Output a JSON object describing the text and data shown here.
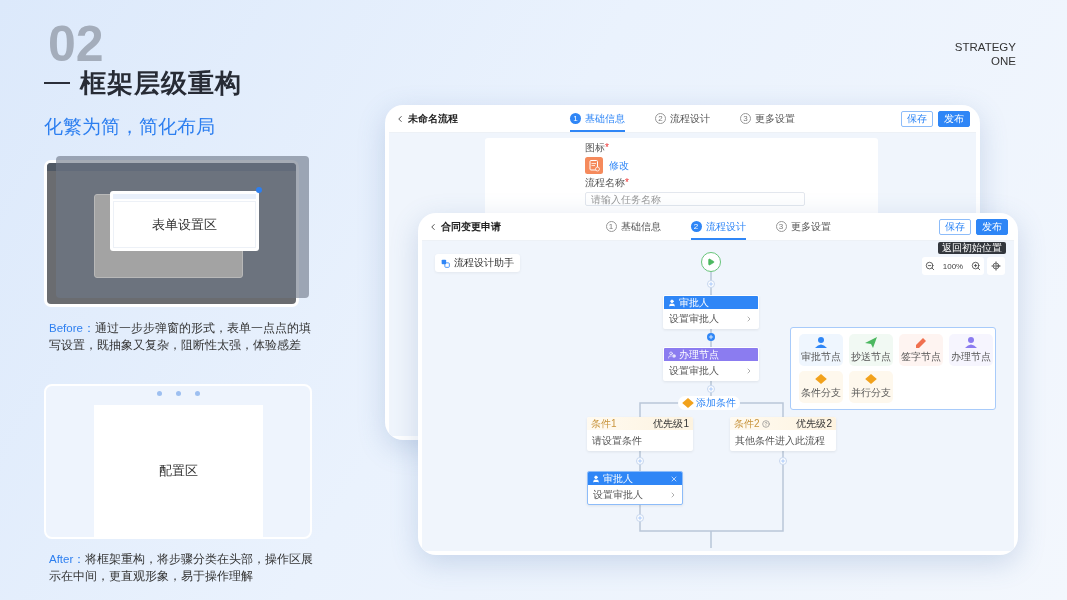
{
  "section_number": "02",
  "title": "框架层级重构",
  "subtitle": "化繁为简，简化布局",
  "before": {
    "label": "表单设置区",
    "caption_lead": "Before：",
    "caption": "通过一步步弹窗的形式，表单一点点的填写设置，既抽象又复杂，阻断性太强，体验感差"
  },
  "after": {
    "label": "配置区",
    "caption_lead": "After：",
    "caption": "将框架重构，将步骤分类在头部，操作区展示在中间，更直观形象，易于操作理解"
  },
  "brand": [
    "STRATEGY",
    "ONE"
  ],
  "back_screen": {
    "title": "未命名流程",
    "steps": [
      {
        "number": "1",
        "label": "基础信息",
        "selected": true
      },
      {
        "number": "2",
        "label": "流程设计",
        "selected": false
      },
      {
        "number": "3",
        "label": "更多设置",
        "selected": false
      }
    ],
    "buttons": [
      {
        "label": "保存",
        "kind": "outline"
      },
      {
        "label": "发布",
        "kind": "primary"
      }
    ],
    "icon_field": {
      "label": "图标",
      "mark": "*",
      "link": "修改"
    },
    "name_field": {
      "label": "流程名称",
      "mark": "*",
      "placeholder": "请输入任务名称"
    }
  },
  "front_screen": {
    "title": "合同变更申请",
    "steps": [
      {
        "number": "1",
        "label": "基础信息",
        "selected": false
      },
      {
        "number": "2",
        "label": "流程设计",
        "selected": true
      },
      {
        "number": "3",
        "label": "更多设置",
        "selected": false
      }
    ],
    "buttons": [
      {
        "label": "保存",
        "kind": "outline"
      },
      {
        "label": "发布",
        "kind": "primary"
      }
    ],
    "assistant": "流程设计助手",
    "zoom": "100%",
    "tooltip": "返回初始位置",
    "nodes": [
      {
        "kind": "approver",
        "title": "审批人",
        "body": "设置审批人",
        "color": "#2f86f6",
        "selected": false
      },
      {
        "kind": "handler",
        "title": "办理节点",
        "body": "设置审批人",
        "color": "#8b7cf0",
        "selected": false
      },
      {
        "kind": "approver",
        "title": "审批人",
        "body": "设置审批人",
        "color": "#2f86f6",
        "selected": true
      }
    ],
    "palette": [
      {
        "kind": "approver",
        "label": "审批节点",
        "color": "#2f86f6"
      },
      {
        "kind": "cc",
        "label": "抄送节点",
        "color": "#4cb860"
      },
      {
        "kind": "sign",
        "label": "签字节点",
        "color": "#f0704f"
      },
      {
        "kind": "handler",
        "label": "办理节点",
        "color": "#8b7cf0"
      },
      {
        "kind": "condition",
        "label": "条件分支",
        "color": "#f2a21c"
      },
      {
        "kind": "parallel",
        "label": "并行分支",
        "color": "#f2a21c"
      }
    ],
    "add_condition": "添加条件",
    "conditions": [
      {
        "label": "条件1",
        "priority": "优先级1",
        "body": "请设置条件",
        "help": false
      },
      {
        "label": "条件2",
        "priority": "优先级2",
        "body": "其他条件进入此流程",
        "help": true
      }
    ]
  }
}
